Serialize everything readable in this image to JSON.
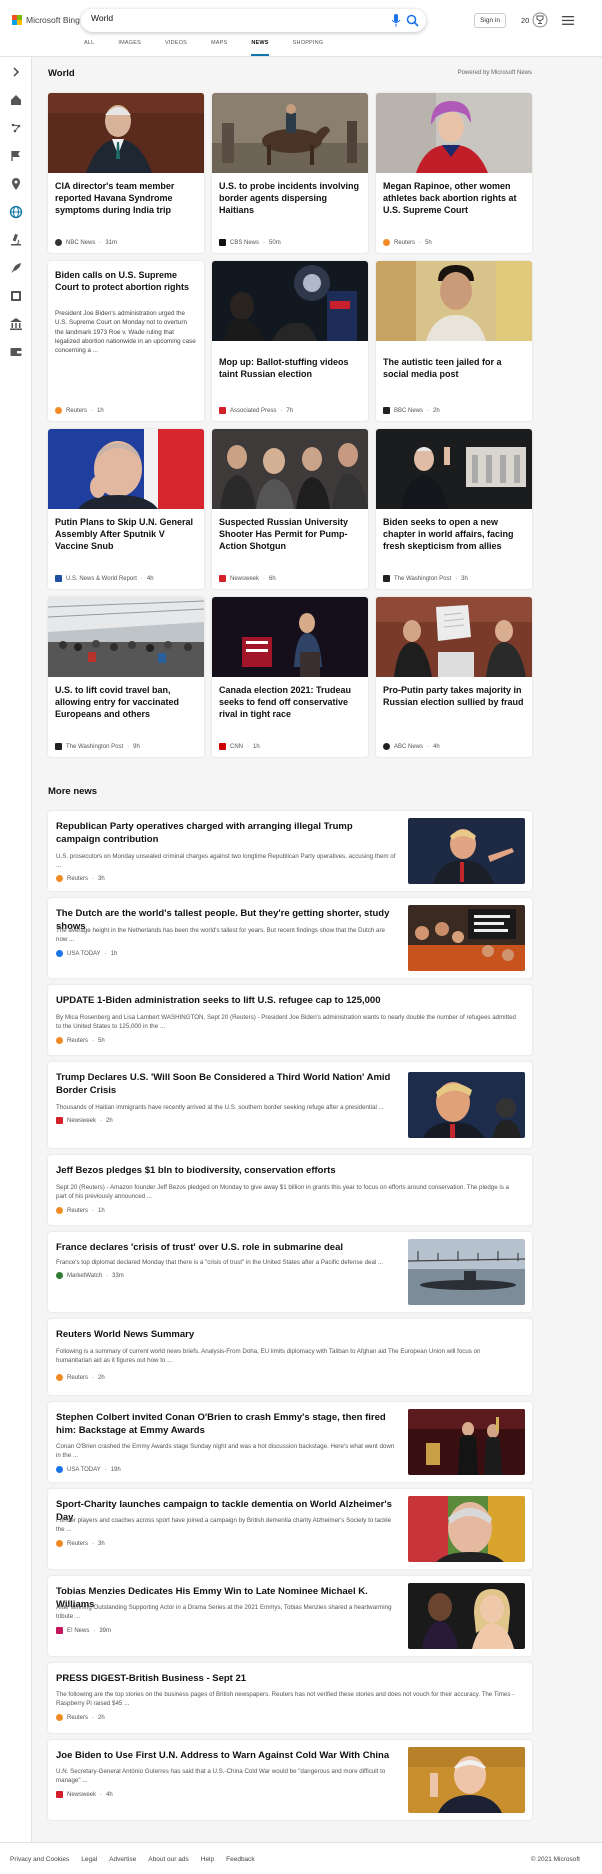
{
  "brand": {
    "logo_text": "Microsoft Bing"
  },
  "search": {
    "value": "World"
  },
  "header": {
    "sign_in": "Sign in",
    "points": "20"
  },
  "tabs": [
    "ALL",
    "IMAGES",
    "VIDEOS",
    "MAPS",
    "NEWS",
    "SHOPPING"
  ],
  "active_tab": "NEWS",
  "section": {
    "title": "World",
    "powered_by": "Powered by Microsoft News"
  },
  "cards": [
    {
      "title": "CIA director's team member reported Havana Syndrome symptoms during India trip",
      "source": "NBC News",
      "age": "31m",
      "source_color": "#333333",
      "image_icon": "man-in-suit-photo"
    },
    {
      "title": "U.S. to probe incidents involving border agents dispersing Haitians",
      "source": "CBS News",
      "age": "50m",
      "source_color": "#111111",
      "image_icon": "horseback-agent-photo"
    },
    {
      "title": "Megan Rapinoe, other women athletes back abortion rights at U.S. Supreme Court",
      "source": "Reuters",
      "age": "5h",
      "source_color": "#f08a24",
      "image_icon": "woman-purple-hair-photo"
    },
    {
      "title": "Biden calls on U.S. Supreme Court to protect abortion rights",
      "abstract": "President Joe Biden's administration urged the U.S. Supreme Court on Monday not to overturn the landmark 1973 Roe v. Wade ruling that legalized abortion nationwide in an upcoming case concerning a ...",
      "source": "Reuters",
      "age": "1h",
      "source_color": "#f08a24"
    },
    {
      "title": "Mop up: Ballot-stuffing videos taint Russian election",
      "source": "Associated Press",
      "age": "7h",
      "source_color": "#d4202b",
      "image_icon": "night-crowd-photo"
    },
    {
      "title": "The autistic teen jailed for a social media post",
      "source": "BBC News",
      "age": "2h",
      "source_color": "#222222",
      "image_icon": "teen-portrait-photo"
    },
    {
      "title": "Putin Plans to Skip U.N. General Assembly After Sputnik V Vaccine Snub",
      "source": "U.S. News & World Report",
      "age": "4h",
      "source_color": "#1c4fa0",
      "image_icon": "putin-photo"
    },
    {
      "title": "Suspected Russian University Shooter Has Permit for Pump-Action Shotgun",
      "source": "Newsweek",
      "age": "6h",
      "source_color": "#d4202b",
      "image_icon": "mourners-photo"
    },
    {
      "title": "Biden seeks to open a new chapter in world affairs, facing fresh skepticism from allies",
      "source": "The Washington Post",
      "age": "3h",
      "source_color": "#222222",
      "image_icon": "biden-waving-photo"
    },
    {
      "title": "U.S. to lift covid travel ban, allowing entry for vaccinated Europeans and others",
      "source": "The Washington Post",
      "age": "9h",
      "source_color": "#222222",
      "image_icon": "airport-crowd-photo"
    },
    {
      "title": "Canada election 2021: Trudeau seeks to fend off conservative rival in tight race",
      "source": "CNN",
      "age": "1h",
      "source_color": "#cc0000",
      "image_icon": "trudeau-stage-photo"
    },
    {
      "title": "Pro-Putin party takes majority in Russian election sullied by fraud",
      "source": "ABC News",
      "age": "4h",
      "source_color": "#222222",
      "image_icon": "ballot-count-photo"
    }
  ],
  "more_news": {
    "title": "More news",
    "items": [
      {
        "title": "Republican Party operatives charged with arranging illegal Trump campaign contribution",
        "snippet": "U.S. prosecutors on Monday unsealed criminal charges against two longtime Republican Party operatives, accusing them of ...",
        "source": "Reuters",
        "age": "3h",
        "source_color": "#f08a24",
        "thumb": "trump-pointing-photo"
      },
      {
        "title": "The Dutch are the world's tallest people. But they're getting shorter, study shows",
        "snippet": "The average height in the Netherlands has been the world's tallest for years. But recent findings show that the Dutch are now ...",
        "source": "USA TODAY",
        "age": "1h",
        "source_color": "#1a73e8",
        "thumb": "dutch-fans-photo"
      },
      {
        "title": "UPDATE 1-Biden administration seeks to lift U.S. refugee cap to 125,000",
        "snippet": "By Mica Rosenberg and Lisa Lambert WASHINGTON, Sept 20 (Reuters) - President Joe Biden's administration wants to nearly double the number of refugees admitted to the United States to 125,000 in the ...",
        "source": "Reuters",
        "age": "5h",
        "source_color": "#f08a24"
      },
      {
        "title": "Trump Declares U.S. 'Will Soon Be Considered a Third World Nation' Amid Border Crisis",
        "snippet": "Thousands of Haitian immigrants have recently arrived at the U.S. southern border seeking refuge after a presidential ...",
        "source": "Newsweek",
        "age": "2h",
        "source_color": "#d4202b",
        "thumb": "trump-portrait-photo"
      },
      {
        "title": "Jeff Bezos pledges $1 bln to biodiversity, conservation efforts",
        "snippet": "Sept 20 (Reuters) - Amazon founder Jeff Bezos pledged on Monday to give away $1 billion in grants this year to focus on efforts around conservation. The pledge is a part of his previously announced ...",
        "source": "Reuters",
        "age": "1h",
        "source_color": "#f08a24"
      },
      {
        "title": "France declares 'crisis of trust' over U.S. role in submarine deal",
        "snippet": "France's top diplomat declared Monday that there is a \"crisis of trust\" in the United States after a Pacific defense deal ...",
        "source": "MarketWatch",
        "age": "33m",
        "source_color": "#2e7d32",
        "thumb": "submarine-photo"
      },
      {
        "title": "Reuters World News Summary",
        "snippet": "Following is a summary of current world news briefs. Analysis-From Doha, EU limits diplomacy with Taliban to Afghan aid The European Union will focus on humanitarian aid as it figures out how to ...",
        "source": "Reuters",
        "age": "2h",
        "source_color": "#f08a24"
      },
      {
        "title": "Stephen Colbert invited Conan O'Brien to crash Emmy's stage, then fired him: Backstage at Emmy Awards",
        "snippet": "Conan O'Brien crashed the Emmy Awards stage Sunday night and was a hot discussion backstage. Here's what went down in the ...",
        "source": "USA TODAY",
        "age": "19h",
        "source_color": "#1a73e8",
        "thumb": "emmy-stage-photo"
      },
      {
        "title": "Sport-Charity launches campaign to tackle dementia on World Alzheimer's Day",
        "snippet": "Former players and coaches across sport have joined a campaign by British dementia charity Alzheimer's Society to tackle the ...",
        "source": "Reuters",
        "age": "3h",
        "source_color": "#f08a24",
        "thumb": "coach-portrait-photo"
      },
      {
        "title": "Tobias Menzies Dedicates His Emmy Win to Late Nominee Michael K. Williams",
        "snippet": "After winning Outstanding Supporting Actor in a Drama Series at the 2021 Emmys, Tobias Menzies shared a heartwarming tribute ...",
        "source": "E! News",
        "age": "39m",
        "source_color": "#c2185b",
        "thumb": "red-carpet-photo"
      },
      {
        "title": "PRESS DIGEST-British Business - Sept 21",
        "snippet": "The following are the top stories on the business pages of British newspapers. Reuters has not verified these stories and does not vouch for their accuracy. The Times - Raspberry Pi raised $45 ...",
        "source": "Reuters",
        "age": "2h",
        "source_color": "#f08a24"
      },
      {
        "title": "Joe Biden to Use First U.N. Address to Warn Against Cold War With China",
        "snippet": "U.N. Secretary-General António Guterres has said that a U.S.-China Cold War would be \"dangerous and more difficult to manage\" ...",
        "source": "Newsweek",
        "age": "4h",
        "source_color": "#d4202b",
        "thumb": "biden-speaking-photo"
      }
    ]
  },
  "footer": {
    "links": [
      "Privacy and Cookies",
      "Legal",
      "Advertise",
      "About our ads",
      "Help",
      "Feedback"
    ],
    "copyright": "© 2021 Microsoft"
  },
  "colors": {
    "accent": "#0e76a8",
    "bing_blue": "#1a73e8"
  }
}
